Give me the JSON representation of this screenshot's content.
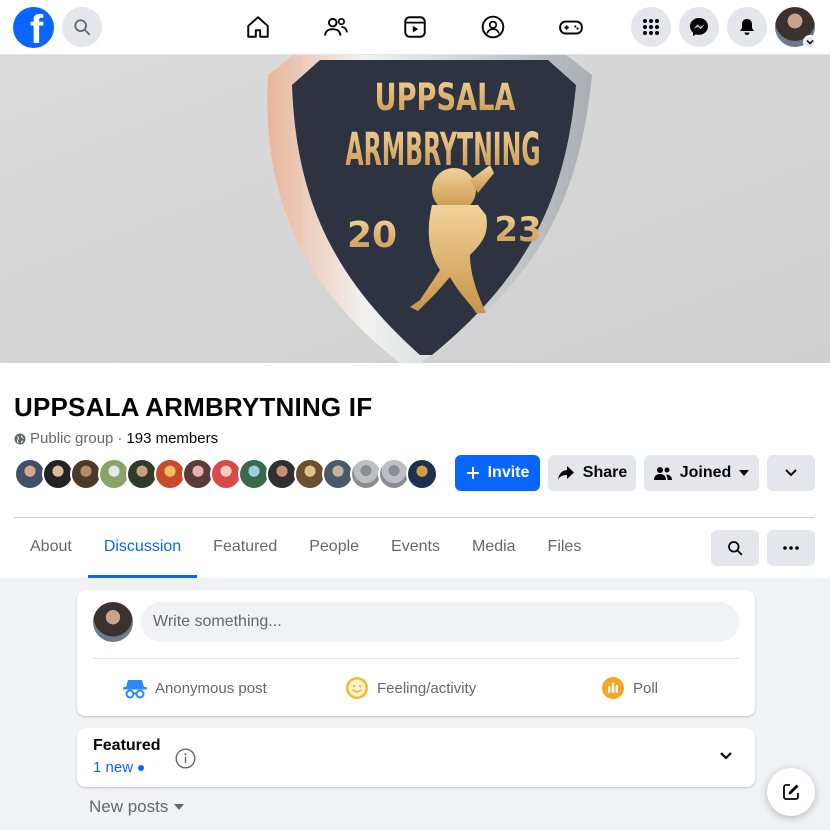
{
  "topbar": {
    "logo": "f",
    "icons": [
      "search-icon",
      "home-icon",
      "friends-icon",
      "watch-icon",
      "groups-icon",
      "gaming-icon",
      "menu-grid-icon",
      "messenger-icon",
      "notifications-icon"
    ]
  },
  "cover": {
    "line1": "UPPSALA",
    "line2": "ARMBRYTNING",
    "year_left": "20",
    "year_right": "23"
  },
  "group": {
    "name": "UPPSALA ARMBRYTNING IF",
    "privacy": "Public group",
    "separator": "·",
    "members": "193 members"
  },
  "actions": {
    "invite": "Invite",
    "share": "Share",
    "joined": "Joined"
  },
  "tabs": [
    "About",
    "Discussion",
    "Featured",
    "People",
    "Events",
    "Media",
    "Files"
  ],
  "composer": {
    "placeholder": "Write something...",
    "anonymous": "Anonymous post",
    "feeling": "Feeling/activity",
    "poll": "Poll"
  },
  "featured": {
    "title": "Featured",
    "new": "1 new"
  },
  "feed": {
    "sort": "New posts"
  },
  "colors": {
    "brand": "#0866ff",
    "background": "#f0f2f5"
  }
}
